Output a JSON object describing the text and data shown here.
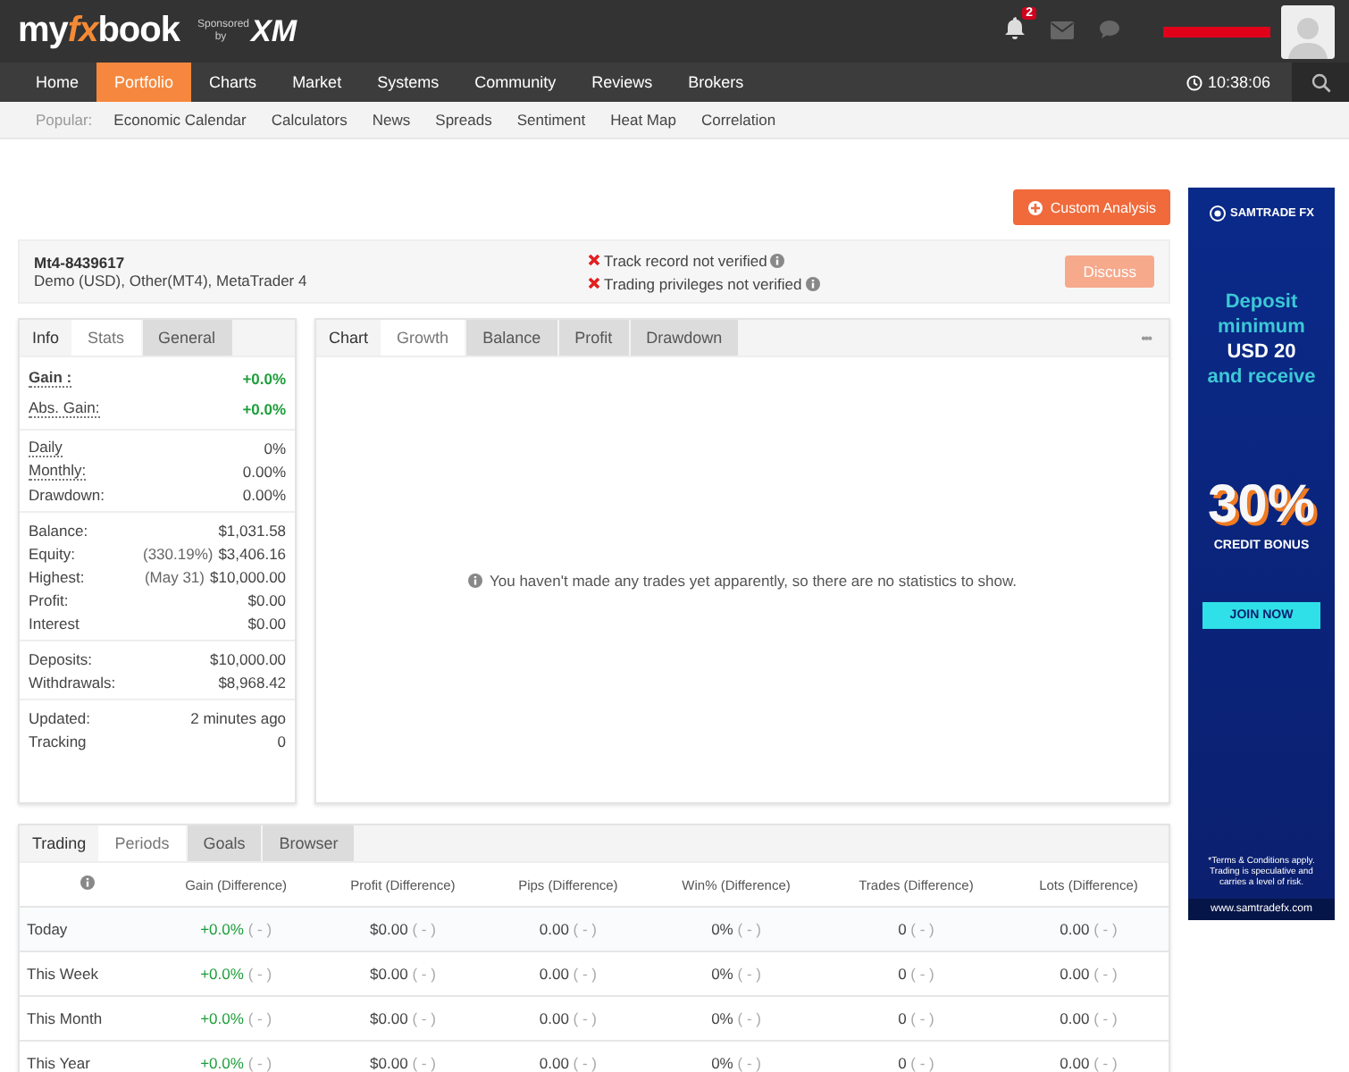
{
  "header": {
    "logo": {
      "my": "my",
      "fx": "fx",
      "book": "book"
    },
    "sponsor_label": "Sponsored by",
    "sponsor_brand": "XM",
    "notifications_count": "2",
    "time": "10:38:06"
  },
  "nav": [
    {
      "label": "Home",
      "selected": false
    },
    {
      "label": "Portfolio",
      "selected": true
    },
    {
      "label": "Charts",
      "selected": false
    },
    {
      "label": "Market",
      "selected": false
    },
    {
      "label": "Systems",
      "selected": false
    },
    {
      "label": "Community",
      "selected": false
    },
    {
      "label": "Reviews",
      "selected": false
    },
    {
      "label": "Brokers",
      "selected": false
    }
  ],
  "popular": {
    "label": "Popular:",
    "links": [
      "Economic Calendar",
      "Calculators",
      "News",
      "Spreads",
      "Sentiment",
      "Heat Map",
      "Correlation"
    ]
  },
  "custom_analysis_button": "Custom Analysis",
  "account": {
    "name": "Mt4-8439617",
    "description": "Demo (USD), Other(MT4), MetaTrader 4",
    "warnings": [
      "Track record not verified",
      "Trading privileges not verified"
    ],
    "discuss_button": "Discuss"
  },
  "stats_panel": {
    "title": "Info",
    "tabs": [
      {
        "label": "Stats",
        "selected": true
      },
      {
        "label": "General",
        "selected": false
      }
    ],
    "groups": [
      [
        {
          "label": "Gain :",
          "value": "+0.0%",
          "positive": true,
          "underlined": true,
          "bold": true
        },
        {
          "label": "Abs. Gain:",
          "value": "+0.0%",
          "positive": true,
          "underlined": true,
          "bold": false
        }
      ],
      [
        {
          "label": "Daily",
          "value": "0%",
          "positive": false,
          "underlined": true,
          "bold": false
        },
        {
          "label": "Monthly:",
          "value": "0.00%",
          "positive": false,
          "underlined": true,
          "bold": false
        },
        {
          "label": "Drawdown:",
          "value": "0.00%",
          "positive": false,
          "underlined": false,
          "bold": false
        }
      ],
      [
        {
          "label": "Balance:",
          "value": "$1,031.58",
          "positive": false,
          "underlined": false,
          "bold": false
        },
        {
          "label": "Equity:",
          "note": "(330.19%)",
          "value": "$3,406.16",
          "positive": false,
          "underlined": false,
          "bold": false
        },
        {
          "label": "Highest:",
          "note": "(May 31)",
          "value": "$10,000.00",
          "positive": false,
          "underlined": false,
          "bold": false
        },
        {
          "label": "Profit:",
          "value": "$0.00",
          "positive": false,
          "underlined": false,
          "bold": false
        },
        {
          "label": "Interest",
          "value": "$0.00",
          "positive": false,
          "underlined": false,
          "bold": false
        }
      ],
      [
        {
          "label": "Deposits:",
          "value": "$10,000.00",
          "positive": false,
          "underlined": false,
          "bold": false
        },
        {
          "label": "Withdrawals:",
          "value": "$8,968.42",
          "positive": false,
          "underlined": false,
          "bold": false
        }
      ],
      [
        {
          "label": "Updated:",
          "value": "2 minutes ago",
          "positive": false,
          "underlined": false,
          "bold": false
        },
        {
          "label": "Tracking",
          "value": "0",
          "positive": false,
          "underlined": false,
          "bold": false
        }
      ]
    ]
  },
  "chart_panel": {
    "title": "Chart",
    "tabs": [
      {
        "label": "Growth",
        "selected": true
      },
      {
        "label": "Balance",
        "selected": false
      },
      {
        "label": "Profit",
        "selected": false
      },
      {
        "label": "Drawdown",
        "selected": false
      }
    ],
    "menu": "•••",
    "message": "You haven't made any trades yet apparently, so there are no statistics to show."
  },
  "periods_panel": {
    "title": "Trading",
    "tabs": [
      {
        "label": "Periods",
        "selected": true
      },
      {
        "label": "Goals",
        "selected": false
      },
      {
        "label": "Browser",
        "selected": false
      }
    ],
    "columns": [
      "Gain (Difference)",
      "Profit (Difference)",
      "Pips (Difference)",
      "Win% (Difference)",
      "Trades (Difference)",
      "Lots (Difference)"
    ],
    "rows": [
      {
        "period": "Today",
        "cells": [
          {
            "value": "+0.0%",
            "diff": "( - )"
          },
          {
            "value": "$0.00",
            "diff": "( - )"
          },
          {
            "value": "0.00",
            "diff": "( - )"
          },
          {
            "value": "0%",
            "diff": "( - )"
          },
          {
            "value": "0",
            "diff": "( - )"
          },
          {
            "value": "0.00",
            "diff": "( - )"
          }
        ]
      },
      {
        "period": "This Week",
        "cells": [
          {
            "value": "+0.0%",
            "diff": "( - )"
          },
          {
            "value": "$0.00",
            "diff": "( - )"
          },
          {
            "value": "0.00",
            "diff": "( - )"
          },
          {
            "value": "0%",
            "diff": "( - )"
          },
          {
            "value": "0",
            "diff": "( - )"
          },
          {
            "value": "0.00",
            "diff": "( - )"
          }
        ]
      },
      {
        "period": "This Month",
        "cells": [
          {
            "value": "+0.0%",
            "diff": "( - )"
          },
          {
            "value": "$0.00",
            "diff": "( - )"
          },
          {
            "value": "0.00",
            "diff": "( - )"
          },
          {
            "value": "0%",
            "diff": "( - )"
          },
          {
            "value": "0",
            "diff": "( - )"
          },
          {
            "value": "0.00",
            "diff": "( - )"
          }
        ]
      },
      {
        "period": "This Year",
        "cells": [
          {
            "value": "+0.0%",
            "diff": "( - )"
          },
          {
            "value": "$0.00",
            "diff": "( - )"
          },
          {
            "value": "0.00",
            "diff": "( - )"
          },
          {
            "value": "0%",
            "diff": "( - )"
          },
          {
            "value": "0",
            "diff": "( - )"
          },
          {
            "value": "0.00",
            "diff": "( - )"
          }
        ]
      }
    ]
  },
  "ad": {
    "brand": "SAMTRADE FX",
    "headline": [
      {
        "text": "Deposit",
        "highlighted": false
      },
      {
        "text": "minimum",
        "highlighted": false
      },
      {
        "text": "USD 20",
        "highlighted": true
      },
      {
        "text": "and receive",
        "highlighted": false
      }
    ],
    "bonus": "30%",
    "bonus_label": "CREDIT BONUS",
    "button": "JOIN NOW",
    "disclaimer": "*Terms & Conditions apply. Trading is speculative and carries a level of risk.",
    "url": "www.samtradefx.com"
  }
}
